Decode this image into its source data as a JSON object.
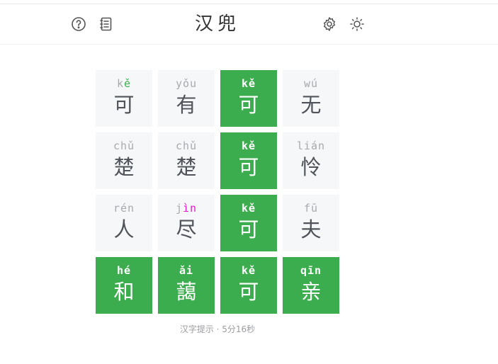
{
  "app": {
    "title": "汉兜"
  },
  "header": {
    "icons": [
      "help-icon",
      "document-icon",
      "settings-icon",
      "theme-sun-icon"
    ]
  },
  "colors": {
    "correct": "#3cad4e",
    "present": "#e01dd2",
    "tile_bg": "#f6f7f9",
    "text_muted": "#a7a9ad",
    "text_char": "#50545a"
  },
  "board": {
    "rows": [
      [
        {
          "initial": "k",
          "final": "ě",
          "initial_state": "none",
          "final_state": "correct",
          "char": "可",
          "win": false
        },
        {
          "initial": "y",
          "final": "ǒu",
          "initial_state": "none",
          "final_state": "none",
          "char": "有",
          "win": false
        },
        {
          "initial": "k",
          "final": "ě",
          "initial_state": "correct",
          "final_state": "correct",
          "char": "可",
          "win": true
        },
        {
          "initial": "w",
          "final": "ú",
          "initial_state": "none",
          "final_state": "none",
          "char": "无",
          "win": false
        }
      ],
      [
        {
          "initial": "ch",
          "final": "ǔ",
          "initial_state": "none",
          "final_state": "none",
          "char": "楚",
          "win": false
        },
        {
          "initial": "ch",
          "final": "ǔ",
          "initial_state": "none",
          "final_state": "none",
          "char": "楚",
          "win": false
        },
        {
          "initial": "k",
          "final": "ě",
          "initial_state": "correct",
          "final_state": "correct",
          "char": "可",
          "win": true
        },
        {
          "initial": "l",
          "final": "ián",
          "initial_state": "none",
          "final_state": "none",
          "char": "怜",
          "win": false
        }
      ],
      [
        {
          "initial": "r",
          "final": "én",
          "initial_state": "none",
          "final_state": "none",
          "char": "人",
          "win": false
        },
        {
          "initial": "j",
          "final": "ìn",
          "initial_state": "none",
          "final_state": "present",
          "char": "尽",
          "win": false
        },
        {
          "initial": "k",
          "final": "ě",
          "initial_state": "correct",
          "final_state": "correct",
          "char": "可",
          "win": true
        },
        {
          "initial": "f",
          "final": "ū",
          "initial_state": "none",
          "final_state": "none",
          "char": "夫",
          "win": false
        }
      ],
      [
        {
          "initial": "h",
          "final": "é",
          "initial_state": "correct",
          "final_state": "correct",
          "char": "和",
          "win": true
        },
        {
          "initial": "",
          "final": "ǎi",
          "initial_state": "correct",
          "final_state": "correct",
          "char": "藹",
          "win": true
        },
        {
          "initial": "k",
          "final": "ě",
          "initial_state": "correct",
          "final_state": "correct",
          "char": "可",
          "win": true
        },
        {
          "initial": "q",
          "final": "īn",
          "initial_state": "correct",
          "final_state": "correct",
          "char": "亲",
          "win": true
        }
      ]
    ]
  },
  "footer": {
    "status": "汉字提示 · 5分16秒"
  }
}
